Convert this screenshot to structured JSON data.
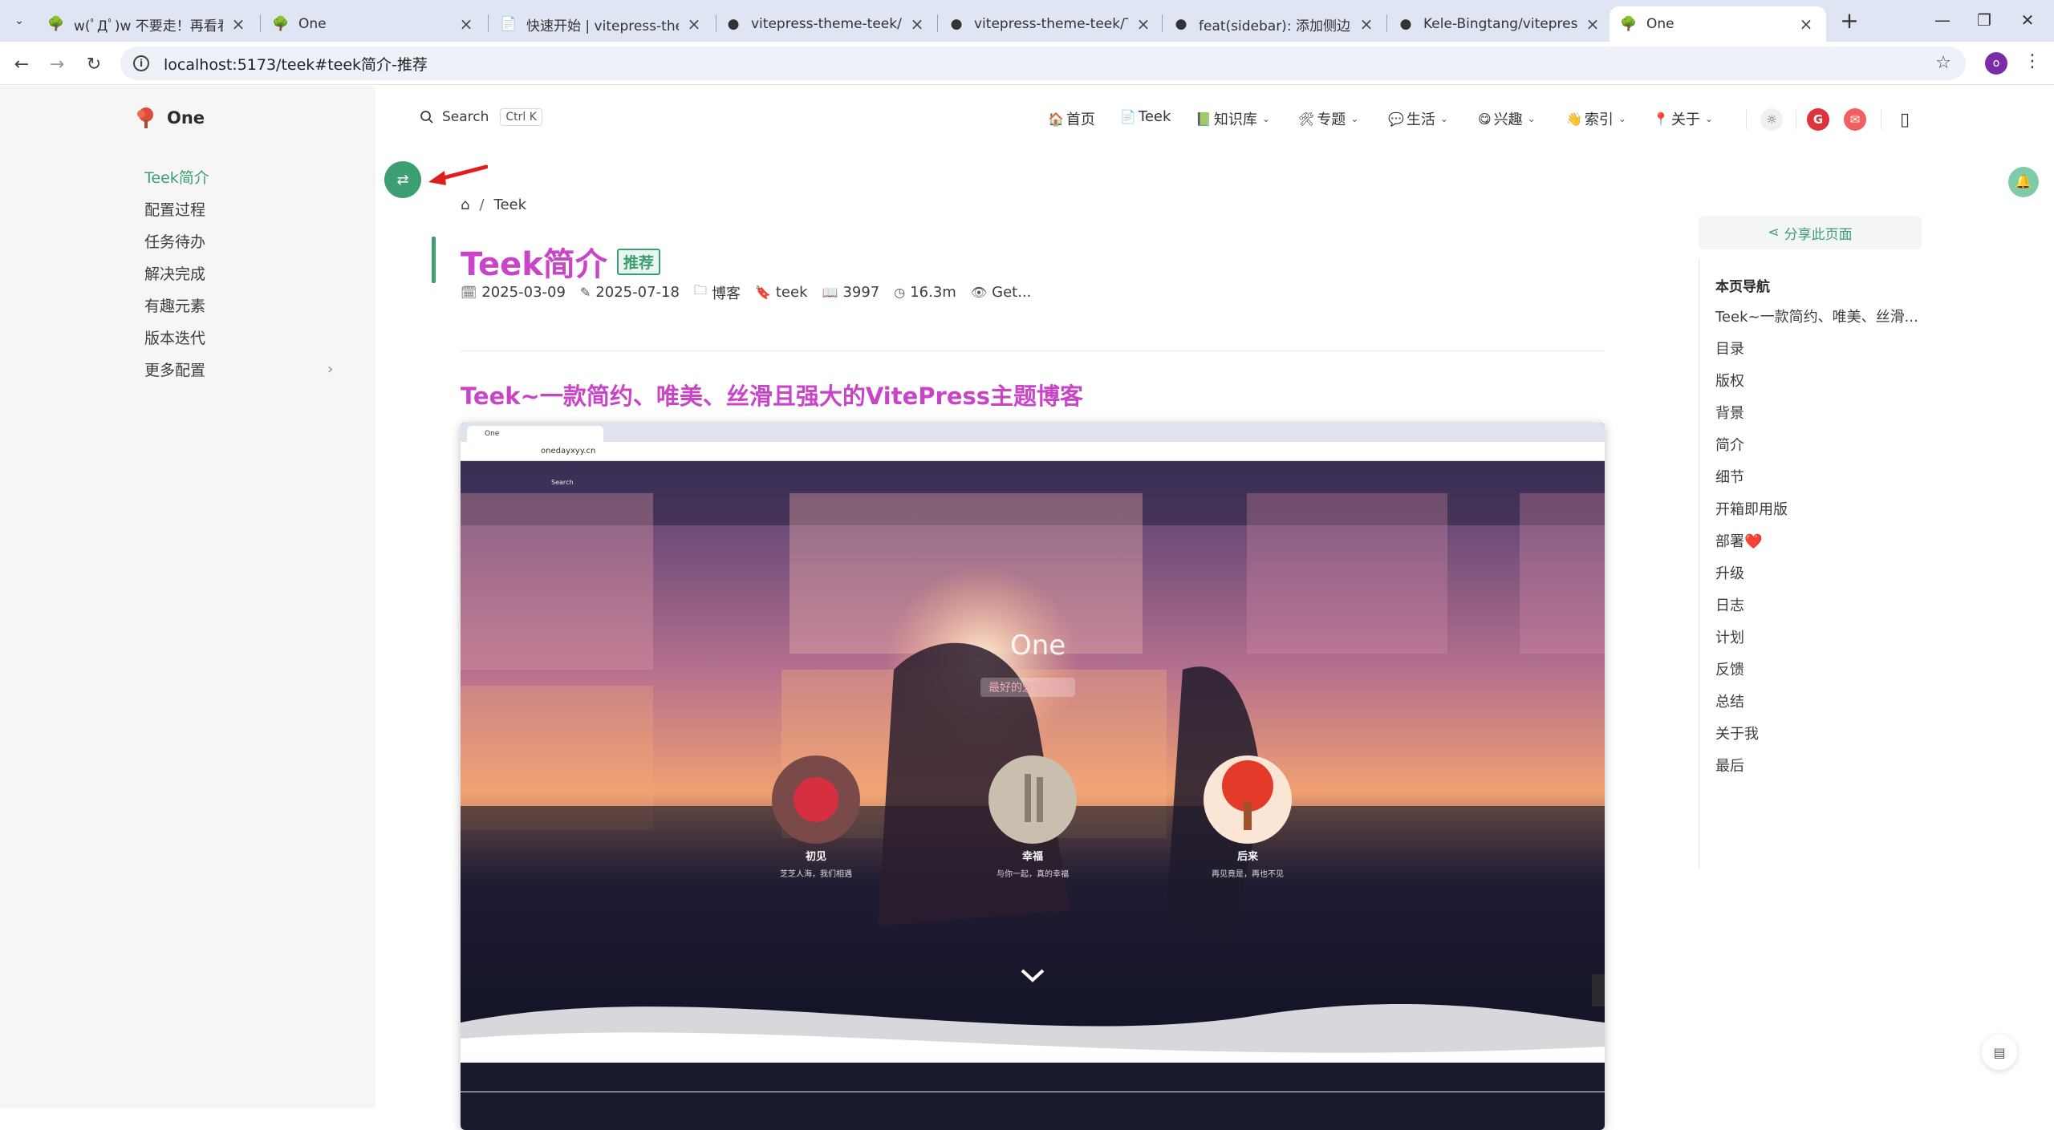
{
  "browser": {
    "tabs": [
      {
        "title": "w(ﾟДﾟ)w 不要走！再看看嘛！"
      },
      {
        "title": "One"
      },
      {
        "title": "快速开始 | vitepress-theme-teek"
      },
      {
        "title": "vitepress-theme-teek/CHANGELOG"
      },
      {
        "title": "vitepress-theme-teek/TODO"
      },
      {
        "title": "feat(sidebar): 添加侧边栏展开"
      },
      {
        "title": "Kele-Bingtang/vitepress-theme-teek"
      },
      {
        "title": "One"
      }
    ],
    "url": "localhost:5173/teek#teek简介-推荐",
    "profile_initial": "o"
  },
  "site": {
    "name": "One",
    "search_label": "Search",
    "search_shortcut": "Ctrl K",
    "nav": [
      {
        "label": "首页",
        "icon": "house-icon",
        "dropdown": false
      },
      {
        "label": "Teek",
        "icon": "note-icon",
        "dropdown": false
      },
      {
        "label": "知识库",
        "icon": "books-icon",
        "dropdown": true
      },
      {
        "label": "专题",
        "icon": "tools-icon",
        "dropdown": true
      },
      {
        "label": "生活",
        "icon": "chat-icon",
        "dropdown": true
      },
      {
        "label": "兴趣",
        "icon": "face-icon",
        "dropdown": true
      },
      {
        "label": "索引",
        "icon": "hand-icon",
        "dropdown": true
      },
      {
        "label": "关于",
        "icon": "pin-icon",
        "dropdown": true
      }
    ]
  },
  "sidebar": {
    "items": [
      {
        "label": "Teek简介"
      },
      {
        "label": "配置过程"
      },
      {
        "label": "任务待办"
      },
      {
        "label": "解决完成"
      },
      {
        "label": "有趣元素"
      },
      {
        "label": "版本迭代"
      },
      {
        "label": "更多配置"
      }
    ]
  },
  "article": {
    "breadcrumb": "Teek",
    "title": "Teek简介",
    "badge": "推荐",
    "meta": {
      "created": "2025-03-09",
      "updated": "2025-07-18",
      "category": "博客",
      "tag": "teek",
      "words": "3997",
      "reading_time": "16.3m",
      "views": "Get..."
    },
    "heading": "Teek~一款简约、唯美、丝滑且强大的VitePress主题博客"
  },
  "screenshot": {
    "tab_title": "One",
    "url": "onedayxyy.cn",
    "hero_title": "One",
    "hero_subtitle": "最好的爱情看我",
    "search": "Search",
    "cards": [
      {
        "title": "初见",
        "desc": "芝芝人海，我们相遇"
      },
      {
        "title": "幸福",
        "desc": "与你一起，真的幸福"
      },
      {
        "title": "后来",
        "desc": "再见竟是，再也不见"
      }
    ]
  },
  "toc": {
    "share": "分享此页面",
    "title": "本页导航",
    "items": [
      "Teek~一款简约、唯美、丝滑...",
      "目录",
      "版权",
      "背景",
      "简介",
      "细节",
      "开箱即用版",
      "部署❤️",
      "升级",
      "日志",
      "计划",
      "反馈",
      "总结",
      "关于我",
      "最后"
    ]
  },
  "colors": {
    "accent": "#3d9e72",
    "title": "#c845c8"
  }
}
